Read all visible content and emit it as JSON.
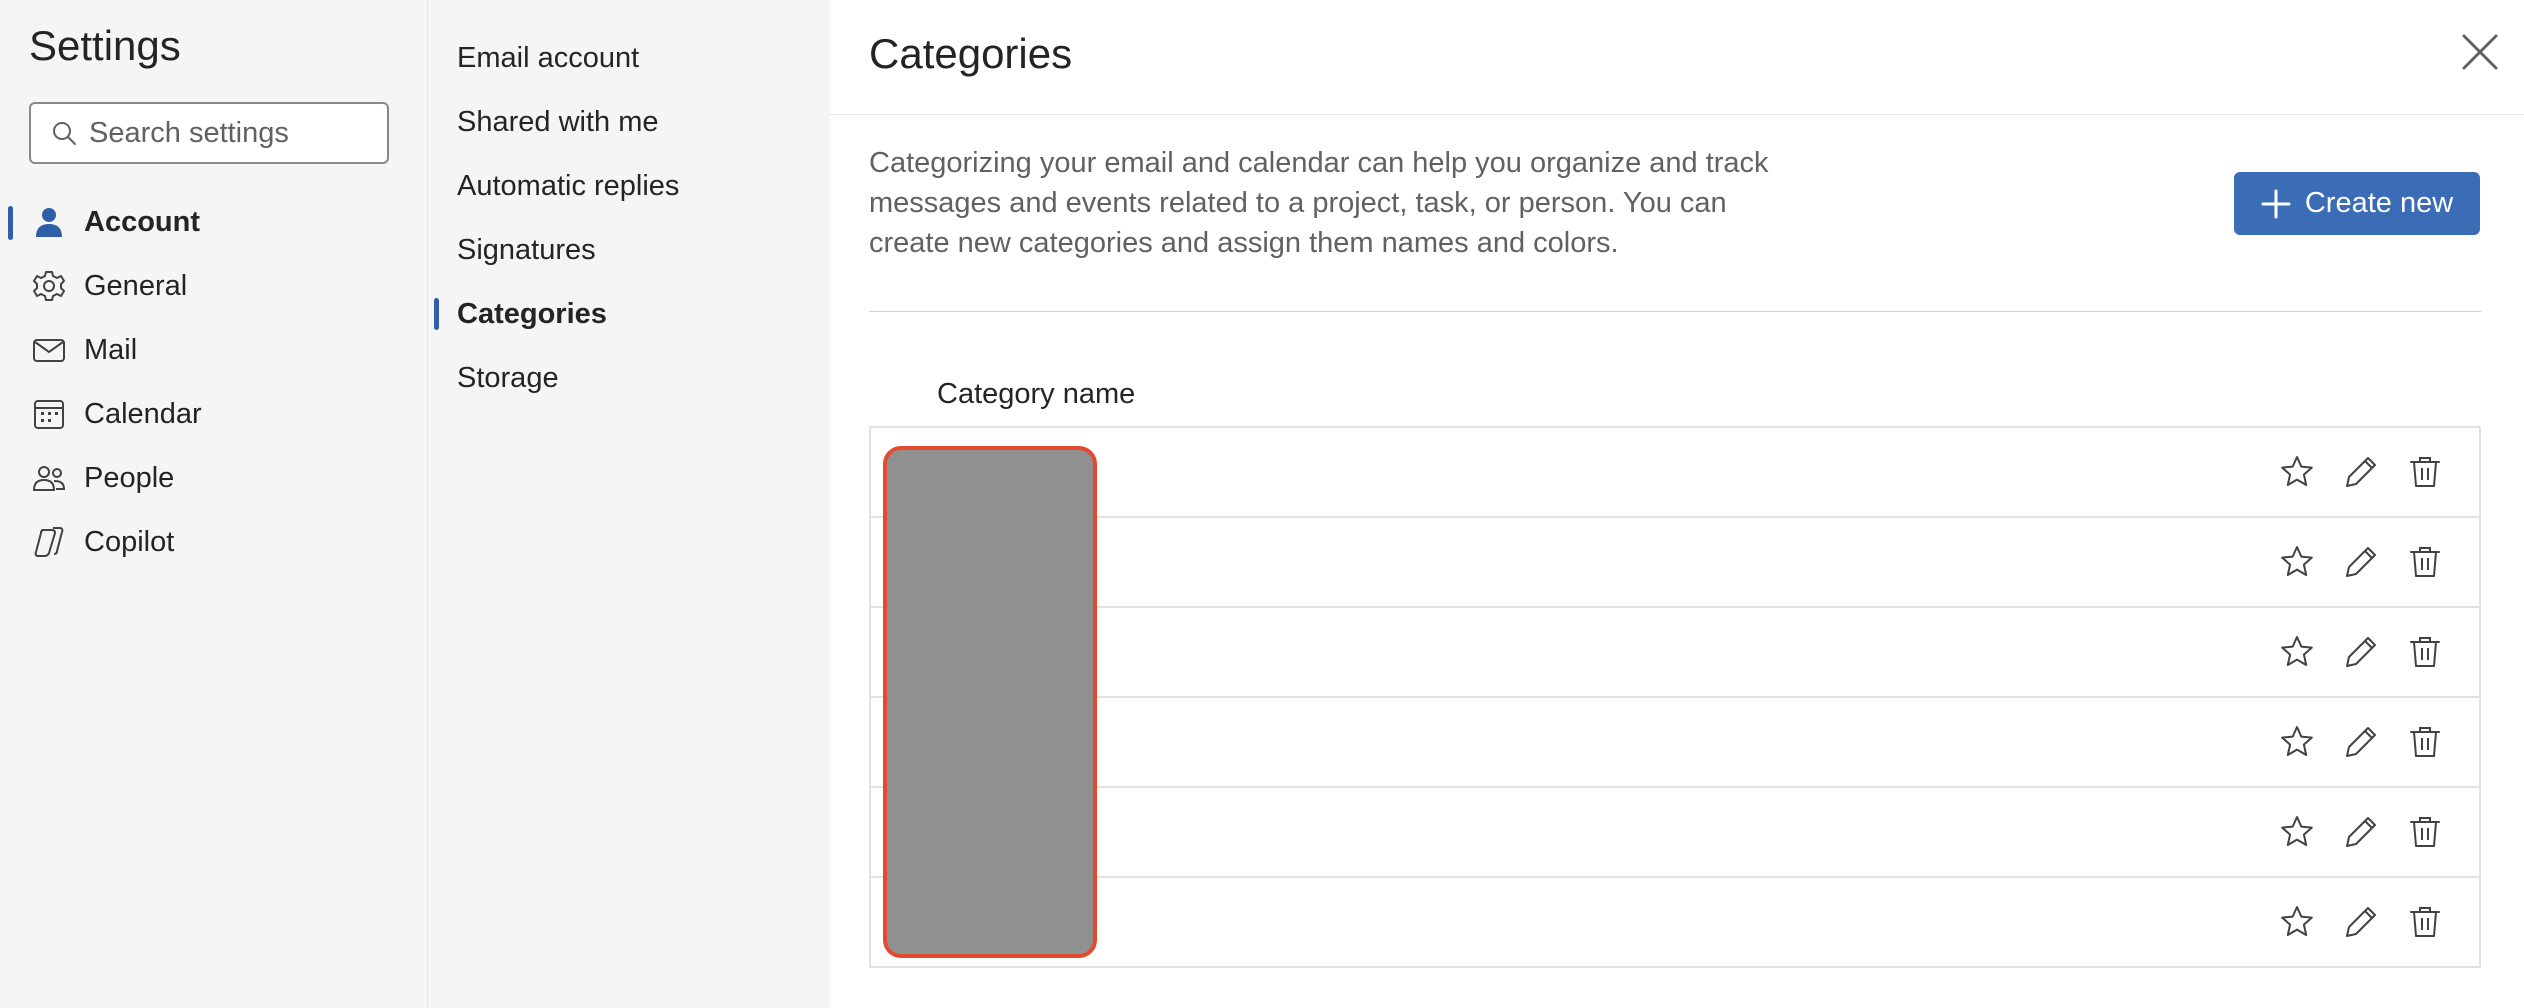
{
  "sidebar": {
    "title": "Settings",
    "search": {
      "placeholder": "Search settings",
      "value": ""
    },
    "items": [
      {
        "label": "Account",
        "icon": "person-icon",
        "active": true
      },
      {
        "label": "General",
        "icon": "gear-icon",
        "active": false
      },
      {
        "label": "Mail",
        "icon": "mail-icon",
        "active": false
      },
      {
        "label": "Calendar",
        "icon": "calendar-icon",
        "active": false
      },
      {
        "label": "People",
        "icon": "people-icon",
        "active": false
      },
      {
        "label": "Copilot",
        "icon": "copilot-icon",
        "active": false
      }
    ]
  },
  "subnav": {
    "items": [
      {
        "label": "Email account",
        "active": false
      },
      {
        "label": "Shared with me",
        "active": false
      },
      {
        "label": "Automatic replies",
        "active": false
      },
      {
        "label": "Signatures",
        "active": false
      },
      {
        "label": "Categories",
        "active": true
      },
      {
        "label": "Storage",
        "active": false
      }
    ]
  },
  "main": {
    "title": "Categories",
    "description": "Categorizing your email and calendar can help you organize and track messages and events related to a project, task, or person. You can create new categories and assign them names and colors.",
    "create_button": "Create new",
    "column_header": "Category name",
    "row_count": 6
  },
  "colors": {
    "accent": "#2f5fa8",
    "button": "#3a6db5",
    "redaction_fill": "#909090",
    "redaction_border": "#e34a2e"
  }
}
